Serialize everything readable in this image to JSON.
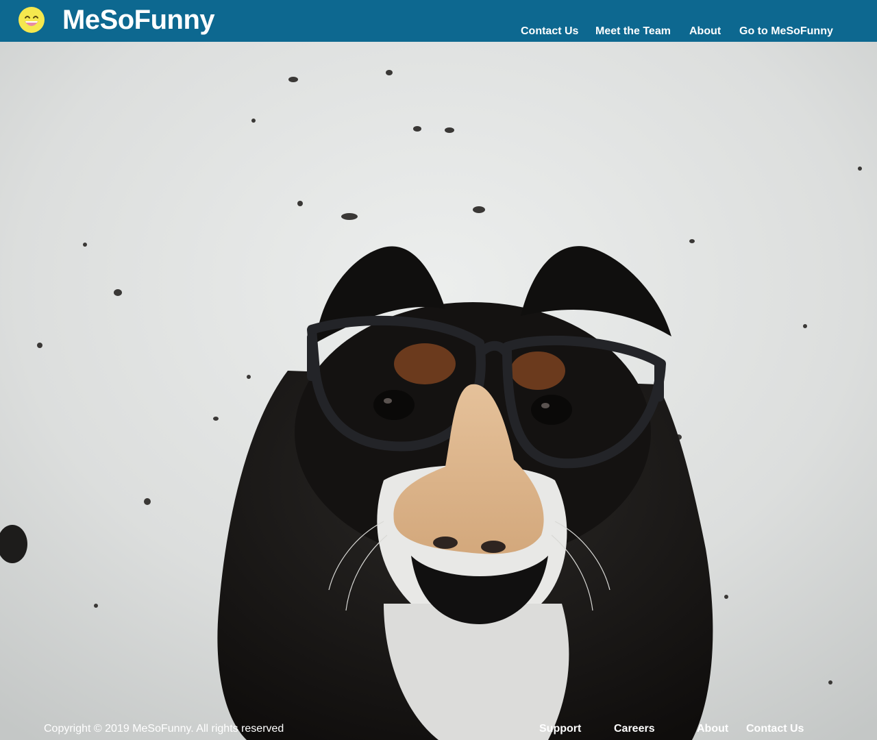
{
  "header": {
    "brand": "MeSoFunny",
    "logo_icon": "laughing-face-icon",
    "nav": [
      {
        "label": "Contact Us"
      },
      {
        "label": "Meet the Team"
      },
      {
        "label": "About"
      },
      {
        "label": "Go to MeSoFunny"
      }
    ]
  },
  "hero": {
    "subject": "dog-wearing-groucho-glasses-photo"
  },
  "footer": {
    "copyright": "Copyright © 2019 MeSoFunny. All rights reserved",
    "links": [
      {
        "label": "Support"
      },
      {
        "label": "Careers"
      },
      {
        "label": "About"
      },
      {
        "label": "Contact Us"
      }
    ]
  },
  "colors": {
    "header_bg": "#0d6890",
    "text": "#ffffff",
    "logo_yellow": "#f6e74b"
  }
}
